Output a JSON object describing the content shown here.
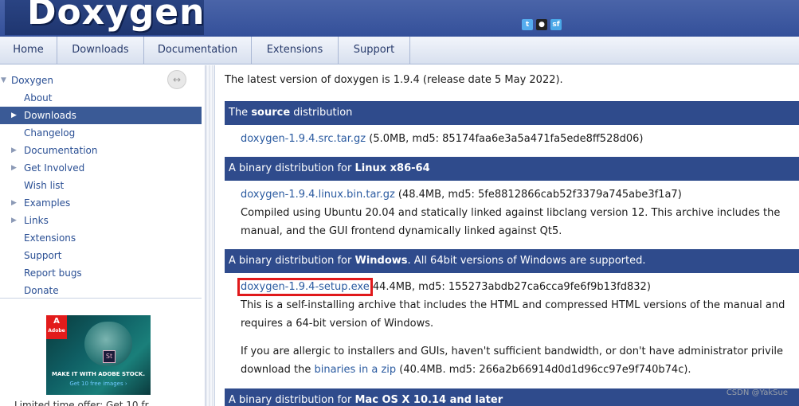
{
  "header": {
    "logo_text": "Doxygen",
    "social": [
      {
        "icon": "twitter-icon",
        "glyph": "t"
      },
      {
        "icon": "github-icon",
        "glyph": "●"
      },
      {
        "icon": "stackoverflow-icon",
        "glyph": "sf"
      }
    ]
  },
  "nav": {
    "items": [
      "Home",
      "Downloads",
      "Documentation",
      "Extensions",
      "Support"
    ]
  },
  "sidebar": {
    "items": [
      {
        "label": "Doxygen",
        "arrow": "▼"
      },
      {
        "label": "About",
        "arrow": ""
      },
      {
        "label": "Downloads",
        "arrow": "▶"
      },
      {
        "label": "Changelog",
        "arrow": ""
      },
      {
        "label": "Documentation",
        "arrow": "▶"
      },
      {
        "label": "Get Involved",
        "arrow": "▶"
      },
      {
        "label": "Wish list",
        "arrow": ""
      },
      {
        "label": "Examples",
        "arrow": "▶"
      },
      {
        "label": "Links",
        "arrow": "▶"
      },
      {
        "label": "Extensions",
        "arrow": ""
      },
      {
        "label": "Support",
        "arrow": ""
      },
      {
        "label": "Report bugs",
        "arrow": ""
      },
      {
        "label": "Donate",
        "arrow": ""
      }
    ],
    "sync_glyph": "↔",
    "ad": {
      "logo": "A",
      "logo_sub": "Adobe",
      "st": "St",
      "line1": "MAKE IT WITH ADOBE STOCK.",
      "line2": "Get 10 free images ›"
    },
    "bottom_text": "Limited time offer: Get 10 fr"
  },
  "content": {
    "intro": "The latest version of doxygen is 1.9.4 (release date 5 May 2022).",
    "source": {
      "head_pre": "The ",
      "head_bold": "source",
      "head_post": " distribution",
      "link": "doxygen-1.9.4.src.tar.gz",
      "info": " (5.0MB, md5: 85174faa6e3a5a471fa5ede8ff528d06)"
    },
    "linux": {
      "head_pre": "A binary distribution for ",
      "head_bold": "Linux x86-64",
      "link": "doxygen-1.9.4.linux.bin.tar.gz",
      "info": " (48.4MB, md5: 5fe8812866cab52f3379a745abe3f1a7)",
      "desc1": "Compiled using Ubuntu 20.04 and statically linked against libclang version 12. This archive includes the",
      "desc2": "manual, and the GUI frontend dynamically linked against Qt5."
    },
    "windows": {
      "head_pre": "A binary distribution for ",
      "head_bold": "Windows",
      "head_post": ". All 64bit versions of Windows are supported.",
      "link": "doxygen-1.9.4-setup.exe",
      "info": " 44.4MB, md5: 155273abdb27ca6cca9fe6f9b13fd832)",
      "desc1": "This is a self-installing archive that includes the HTML and compressed HTML versions of the manual and",
      "desc2": "requires a 64-bit version of Windows.",
      "alt1": "If you are allergic to installers and GUIs, haven't sufficient bandwidth, or don't have administrator privile",
      "alt2_pre": "download the ",
      "alt2_link": "binaries in a zip",
      "alt2_post": " (40.4MB. md5: 266a2b66914d0d1d96cc97e9f740b74c)."
    },
    "mac": {
      "head_pre": "A binary distribution for ",
      "head_bold": "Mac OS X 10.14 and later"
    }
  },
  "watermark": "CSDN @YakSue",
  "colors": {
    "header_bg": "#3d579b",
    "section_head_bg": "#2f4b8c",
    "link": "#2a5aa0",
    "highlight_box": "#e0191b",
    "selected_nav_bg": "#3a5a96"
  }
}
